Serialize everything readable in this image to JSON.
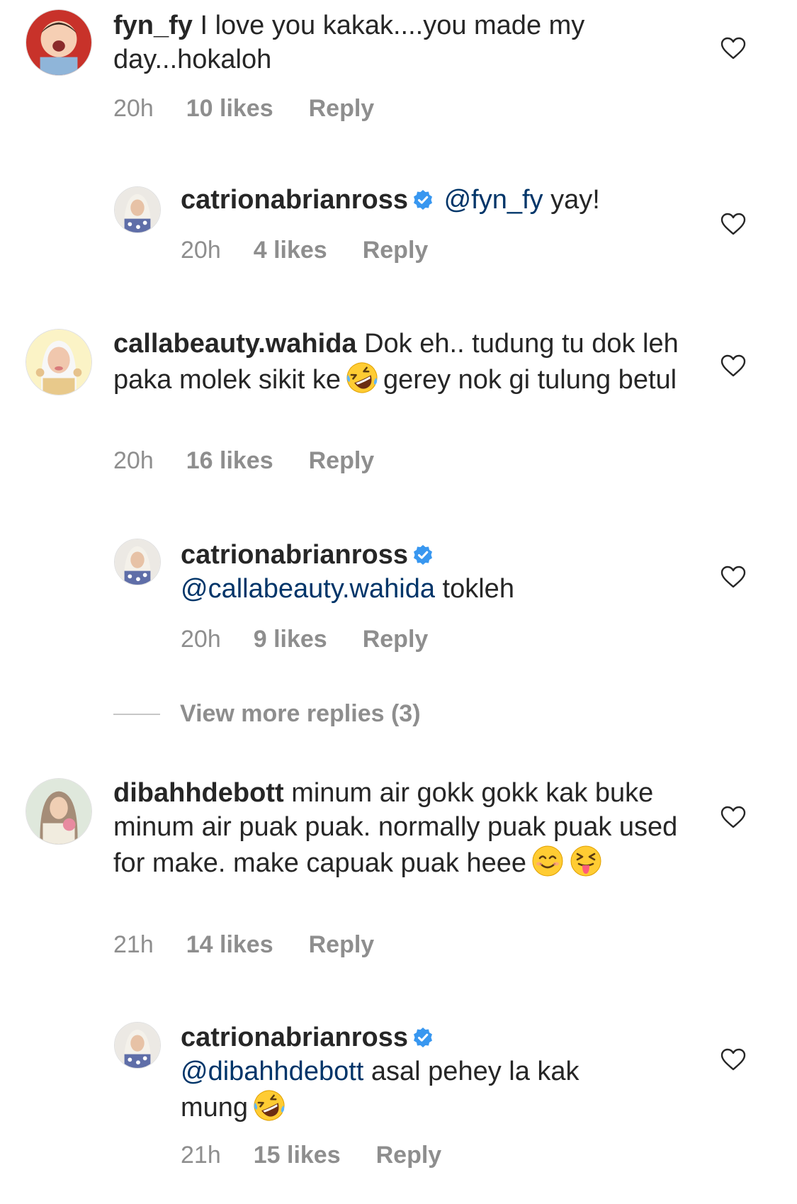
{
  "comments": [
    {
      "username": "fyn_fy",
      "text": "I love you kakak....you made my day...hokaloh",
      "time": "20h",
      "likes": "10 likes",
      "reply": "Reply"
    },
    {
      "username": "catrionabrianross",
      "mention": "@fyn_fy",
      "text": "yay!",
      "time": "20h",
      "likes": "4 likes",
      "reply": "Reply"
    },
    {
      "username": "callabeauty.wahida",
      "text_before": "Dok eh.. tudung tu dok leh paka molek sikit ke",
      "text_after": "gerey nok gi tulung betul",
      "time": "20h",
      "likes": "16 likes",
      "reply": "Reply"
    },
    {
      "username": "catrionabrianross",
      "mention": "@callabeauty.wahida",
      "text": "tokleh",
      "time": "20h",
      "likes": "9 likes",
      "reply": "Reply"
    },
    {
      "username": "dibahhdebott",
      "text": "minum air gokk gokk kak buke minum air puak puak. normally puak puak used for make. make capuak puak heee",
      "time": "21h",
      "likes": "14 likes",
      "reply": "Reply"
    },
    {
      "username": "catrionabrianross",
      "mention": "@dibahhdebott",
      "text": "asal pehey la kak mung",
      "time": "21h",
      "likes": "15 likes",
      "reply": "Reply"
    }
  ],
  "view_more": "View more replies (3)",
  "icons": {
    "like": "heart-outline-icon",
    "verified": "verified-badge-icon",
    "laugh": "rolling-on-floor-laughing-emoji",
    "smile": "smiling-face-emoji",
    "tongue": "squinting-tongue-emoji"
  },
  "colors": {
    "text": "#262626",
    "meta": "#8e8e8e",
    "mention": "#003569",
    "verified": "#3897f0"
  }
}
